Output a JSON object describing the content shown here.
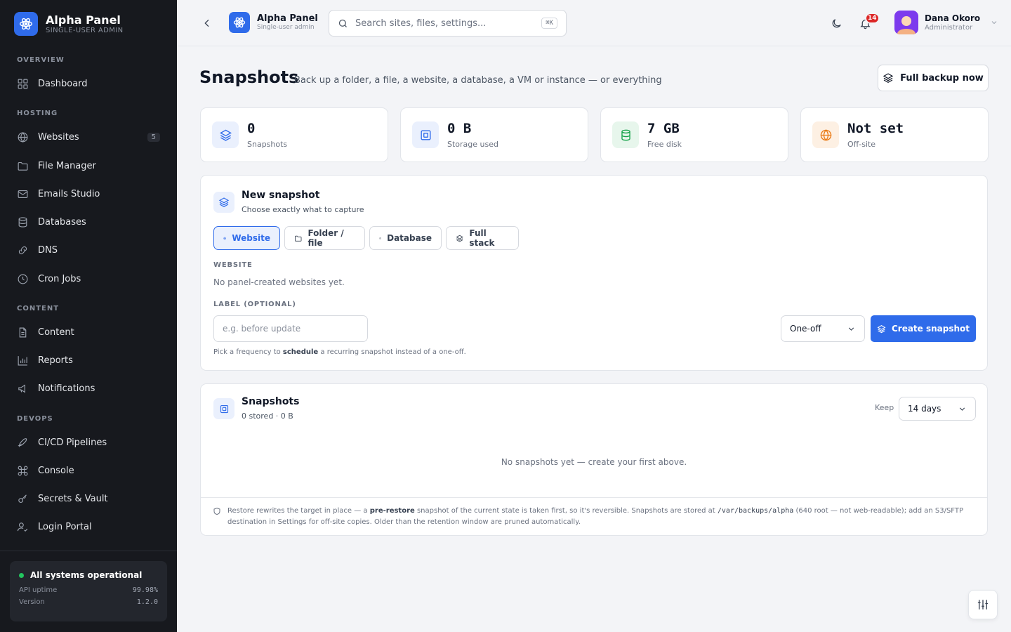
{
  "colors": {
    "accent": "#2f6bea",
    "sidebar_bg": "#17191e",
    "success": "#22c55e",
    "danger": "#dc2626"
  },
  "brand": {
    "name": "Alpha Panel",
    "subtitle": "SINGLE-USER ADMIN",
    "logo_icon": "atom-icon"
  },
  "sidebar": {
    "sections": [
      {
        "title": "OVERVIEW",
        "items": [
          {
            "label": "Dashboard",
            "icon": "grid-icon"
          }
        ]
      },
      {
        "title": "HOSTING",
        "items": [
          {
            "label": "Websites",
            "icon": "globe-icon",
            "badge": "5"
          },
          {
            "label": "File Manager",
            "icon": "folder-icon"
          },
          {
            "label": "Emails Studio",
            "icon": "mail-icon"
          },
          {
            "label": "Databases",
            "icon": "database-icon"
          },
          {
            "label": "DNS",
            "icon": "dns-icon"
          },
          {
            "label": "Cron Jobs",
            "icon": "clock-icon"
          }
        ]
      },
      {
        "title": "CONTENT",
        "items": [
          {
            "label": "Content",
            "icon": "document-icon"
          },
          {
            "label": "Reports",
            "icon": "bar-chart-icon"
          },
          {
            "label": "Notifications",
            "icon": "megaphone-icon"
          }
        ]
      },
      {
        "title": "DEVOPS",
        "items": [
          {
            "label": "CI/CD Pipelines",
            "icon": "rocket-icon"
          },
          {
            "label": "Console",
            "icon": "command-icon"
          },
          {
            "label": "Secrets & Vault",
            "icon": "key-icon"
          },
          {
            "label": "Login Portal",
            "icon": "user-check-icon"
          }
        ]
      }
    ],
    "status": {
      "title": "All systems operational",
      "rows": [
        {
          "label": "API uptime",
          "value": "99.98%"
        },
        {
          "label": "Version",
          "value": "1.2.0"
        }
      ]
    }
  },
  "topbar": {
    "brand_name": "Alpha Panel",
    "brand_sub": "Single-user admin",
    "search_placeholder": "Search sites, files, settings...",
    "search_shortcut": "⌘K",
    "notifications_count": "14",
    "user": {
      "name": "Dana Okoro",
      "role": "Administrator"
    }
  },
  "page": {
    "title": "Snapshots",
    "subtitle": "Back up a folder, a file, a website, a database, a VM or instance — or everything",
    "full_backup_label": "Full backup now"
  },
  "stats": [
    {
      "value": "0",
      "label": "Snapshots",
      "icon": "layers-icon",
      "bg": "#eaf0fd",
      "fg": "#2f6bea"
    },
    {
      "value": "0 B",
      "label": "Storage used",
      "icon": "disk-icon",
      "bg": "#eaf0fd",
      "fg": "#2f6bea"
    },
    {
      "value": "7 GB",
      "label": "Free disk",
      "icon": "database-icon",
      "bg": "#e7f6ec",
      "fg": "#16a34a"
    },
    {
      "value": "Not set",
      "label": "Off-site",
      "icon": "globe-icon",
      "bg": "#fdf0e3",
      "fg": "#ea7a15"
    }
  ],
  "new_snapshot": {
    "title": "New snapshot",
    "subtitle": "Choose exactly what to capture",
    "tabs": [
      {
        "label": "Website",
        "icon": "globe-icon",
        "active": true
      },
      {
        "label": "Folder / file",
        "icon": "folder-icon",
        "active": false
      },
      {
        "label": "Database",
        "icon": "database-icon",
        "active": false
      },
      {
        "label": "Full stack",
        "icon": "layers-icon",
        "active": false
      }
    ],
    "website_label": "WEBSITE",
    "website_empty": "No panel-created websites yet.",
    "label_field_label": "LABEL (OPTIONAL)",
    "label_placeholder": "e.g. before update",
    "frequency_value": "One-off",
    "create_label": "Create snapshot",
    "hint_before": "Pick a frequency to ",
    "hint_bold": "schedule",
    "hint_after": " a recurring snapshot instead of a one-off."
  },
  "snapshots_list": {
    "title": "Snapshots",
    "subtitle": "0 stored · 0 B",
    "keep_label": "Keep",
    "keep_value": "14 days",
    "empty": "No snapshots yet — create your first above.",
    "footer": {
      "p1": "Restore rewrites the target in place — a ",
      "b1": "pre-restore",
      "p2": " snapshot of the current state is taken first, so it's reversible. Snapshots are stored at ",
      "path": "/var/backups/alpha",
      "p3": " (640 root — not web-readable); add an S3/SFTP destination in Settings for off-site copies. Older than the retention window are pruned automatically."
    }
  }
}
